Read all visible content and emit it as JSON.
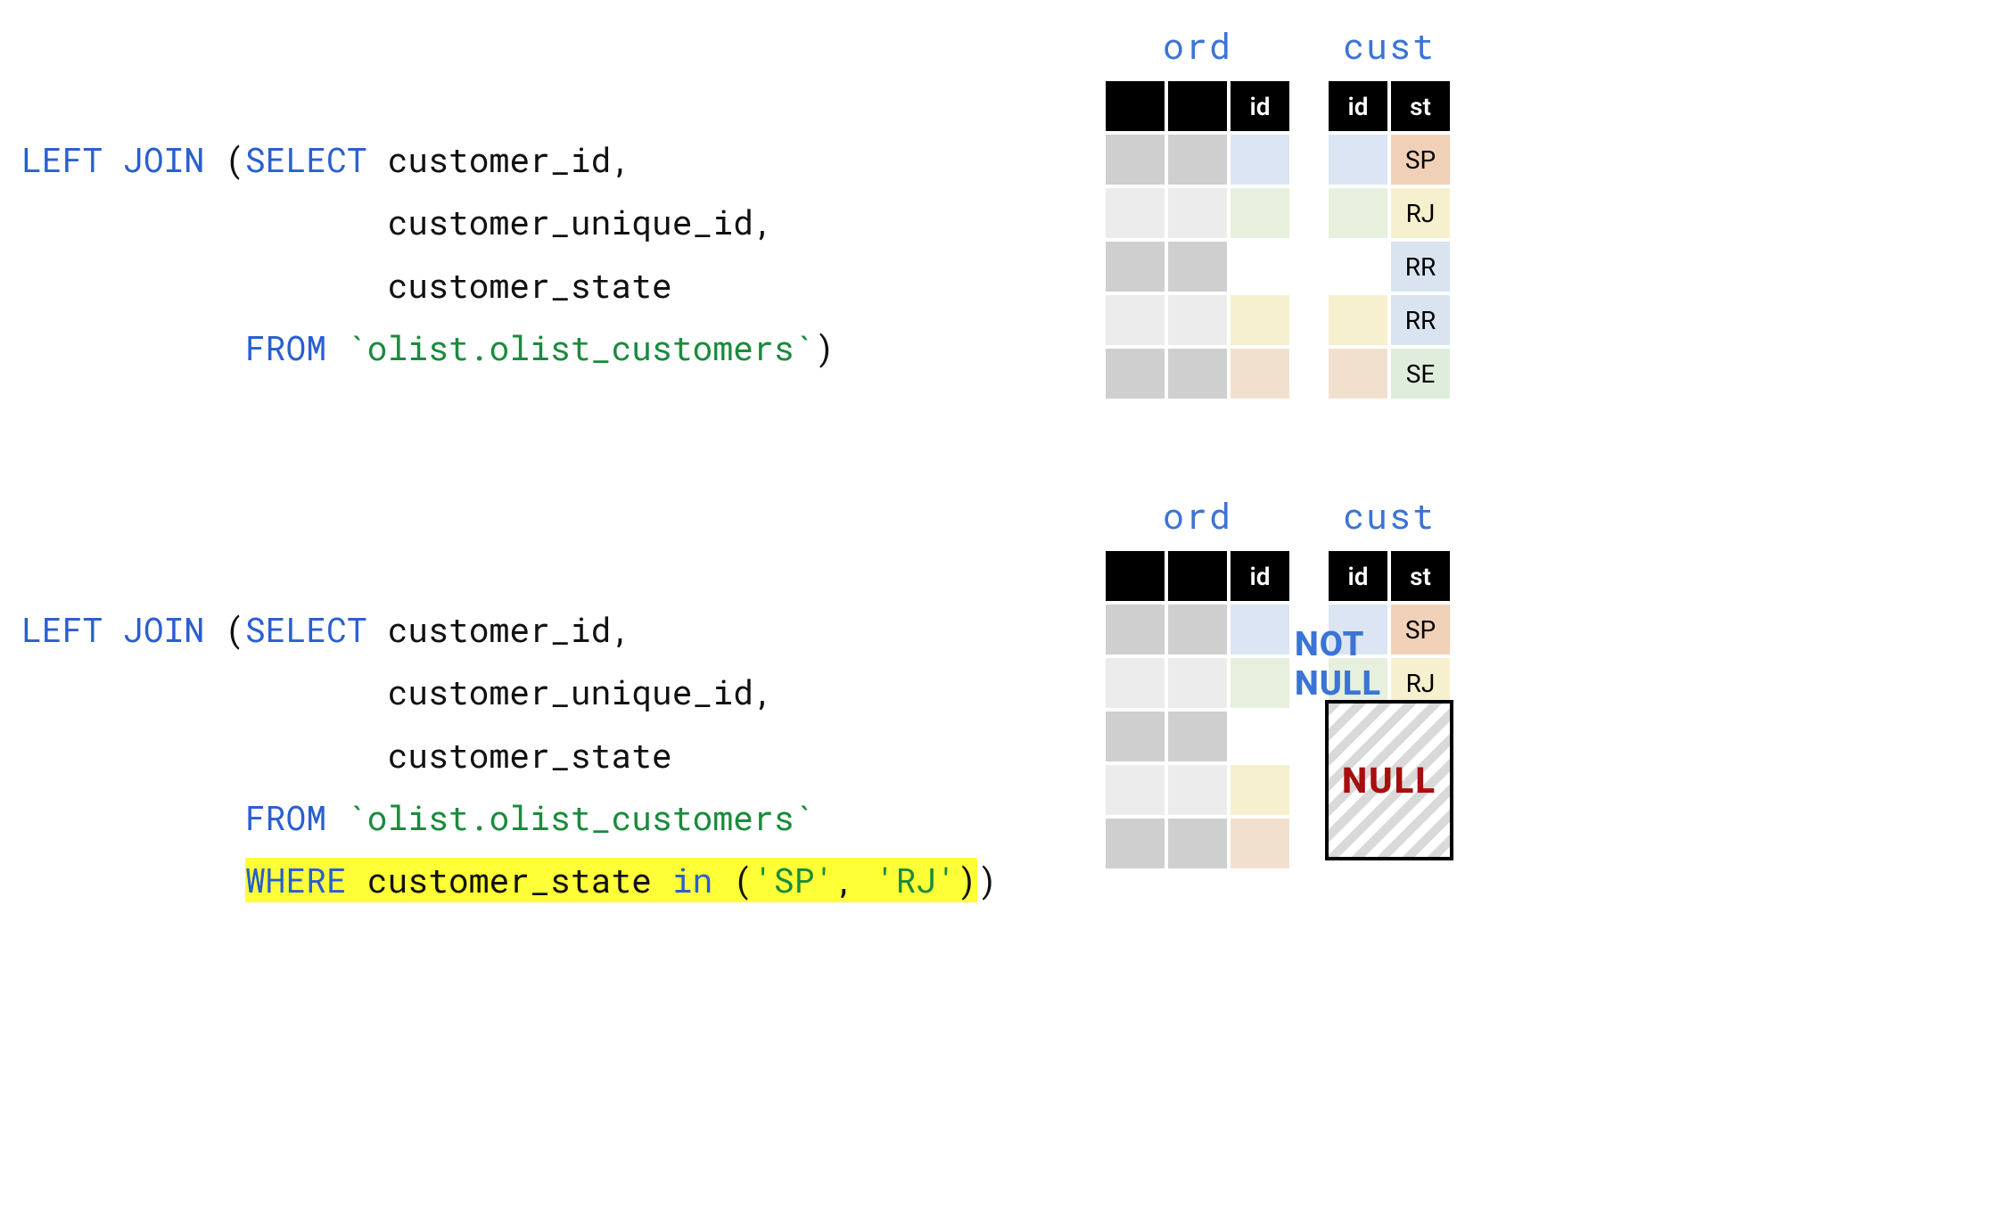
{
  "colors": {
    "gray_dark": "#cfcfcf",
    "gray_light": "#ececec",
    "blue_light": "#dce5f3",
    "green_light": "#e6f0dc",
    "yellow_light": "#f7f0ce",
    "orange_light": "#f2e0ce",
    "peach": "#f0d1b8",
    "blue_soft": "#d9e4f0",
    "green_soft": "#dfeedc",
    "white": "#ffffff"
  },
  "code1": {
    "l1a": "LEFT JOIN ",
    "l1b": "(",
    "l1c": "SELECT ",
    "l1d": "customer_id,",
    "l2": "                  customer_unique_id,",
    "l3": "                  customer_state",
    "l4a": "           ",
    "l4b": "FROM ",
    "l4c": "`olist.olist_customers`",
    "l4d": ")"
  },
  "code2": {
    "l1a": "LEFT JOIN ",
    "l1b": "(",
    "l1c": "SELECT ",
    "l1d": "customer_id,",
    "l2": "                  customer_unique_id,",
    "l3": "                  customer_state",
    "l4a": "           ",
    "l4b": "FROM ",
    "l4c": "`olist.olist_customers`",
    "l5a": "           ",
    "l5b": "WHERE ",
    "l5c": "customer_state ",
    "l5d": "in ",
    "l5e": "(",
    "l5f": "'SP'",
    "l5g": ", ",
    "l5h": "'RJ'",
    "l5i": ")",
    "l5j": ")"
  },
  "labels": {
    "ord_title": "ord",
    "cust_title": "cust",
    "id": "id",
    "st": "st",
    "not_null": "NOT NULL",
    "null": "NULL"
  },
  "tables": {
    "block1": {
      "ord": {
        "headers": [
          "",
          "",
          "id"
        ],
        "rows": [
          {
            "c": [
              "gray_dark",
              "gray_dark",
              "blue_light"
            ]
          },
          {
            "c": [
              "gray_light",
              "gray_light",
              "green_light"
            ]
          },
          {
            "c": [
              "gray_dark",
              "gray_dark",
              "white"
            ]
          },
          {
            "c": [
              "gray_light",
              "gray_light",
              "yellow_light"
            ]
          },
          {
            "c": [
              "gray_dark",
              "gray_dark",
              "orange_light"
            ]
          }
        ]
      },
      "cust": {
        "headers": [
          "id",
          "st"
        ],
        "rows": [
          {
            "c": [
              "blue_light",
              "peach"
            ],
            "v": [
              "",
              "SP"
            ]
          },
          {
            "c": [
              "green_light",
              "yellow_light"
            ],
            "v": [
              "",
              "RJ"
            ]
          },
          {
            "c": [
              "white",
              "blue_soft"
            ],
            "v": [
              "",
              "RR"
            ]
          },
          {
            "c": [
              "yellow_light",
              "blue_soft"
            ],
            "v": [
              "",
              "RR"
            ]
          },
          {
            "c": [
              "orange_light",
              "green_soft"
            ],
            "v": [
              "",
              "SE"
            ]
          }
        ]
      }
    },
    "block2": {
      "ord": {
        "headers": [
          "",
          "",
          "id"
        ],
        "rows": [
          {
            "c": [
              "gray_dark",
              "gray_dark",
              "blue_light"
            ]
          },
          {
            "c": [
              "gray_light",
              "gray_light",
              "green_light"
            ]
          },
          {
            "c": [
              "gray_dark",
              "gray_dark",
              "white"
            ]
          },
          {
            "c": [
              "gray_light",
              "gray_light",
              "yellow_light"
            ]
          },
          {
            "c": [
              "gray_dark",
              "gray_dark",
              "orange_light"
            ]
          }
        ]
      },
      "cust": {
        "headers": [
          "id",
          "st"
        ],
        "rows": [
          {
            "c": [
              "blue_light",
              "peach"
            ],
            "v": [
              "",
              "SP"
            ]
          },
          {
            "c": [
              "green_light",
              "yellow_light"
            ],
            "v": [
              "",
              "RJ"
            ]
          },
          {
            "c": [
              "white",
              "white"
            ],
            "v": [
              "",
              ""
            ]
          },
          {
            "c": [
              "white",
              "white"
            ],
            "v": [
              "",
              ""
            ]
          },
          {
            "c": [
              "white",
              "white"
            ],
            "v": [
              "",
              ""
            ]
          }
        ]
      }
    }
  }
}
